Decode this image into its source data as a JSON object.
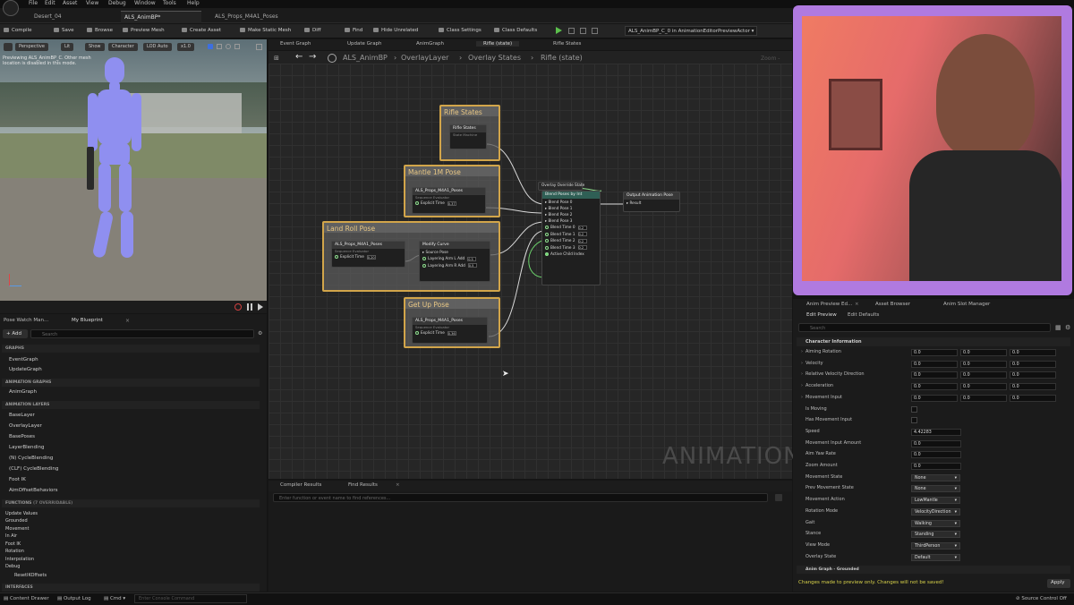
{
  "menu": [
    "File",
    "Edit",
    "Asset",
    "View",
    "Debug",
    "Window",
    "Tools",
    "Help"
  ],
  "doc_tabs": [
    "Desert_04",
    "ALS_AnimBP*",
    "ALS_Props_M4A1_Poses"
  ],
  "compile_label": "Compile",
  "toolbar": [
    "Save",
    "Browse",
    "Preview Mesh",
    "Create Asset",
    "Make Static Mesh",
    "Diff",
    "Find",
    "Hide Unrelated",
    "Class Settings",
    "Class Defaults"
  ],
  "debug_object": "ALS_AnimBP_C_0 in AnimationEditorPreviewActor",
  "viewport": {
    "buttons": [
      "Perspective",
      "Lit",
      "Show",
      "Character",
      "LOD Auto",
      "x1.0"
    ],
    "message": "Previewing ALS_AnimBP_C. Other mesh location is disabled in this mode."
  },
  "graph_tabs": [
    "Event Graph",
    "Update Graph",
    "AnimGraph",
    "Rifle (state)",
    "Rifle States"
  ],
  "breadcrumb": [
    "ALS_AnimBP",
    "OverlayLayer",
    "Overlay States",
    "Rifle (state)"
  ],
  "zoom": "Zoom -",
  "comments": {
    "rifle_states": "Rifle States",
    "mantle": "Mantle 1M Pose",
    "land_roll": "Land Roll Pose",
    "get_up": "Get Up Pose"
  },
  "nodes": {
    "rifle_states": {
      "title": "Rifle States",
      "sub": "State Machine"
    },
    "mantle_seq": {
      "title": "ALS_Props_M4A1_Poses",
      "sub": "Sequence Evaluator",
      "pin": "Explicit Time",
      "val": "0.37"
    },
    "land_seq": {
      "title": "ALS_Props_M4A1_Poses",
      "sub": "Sequence Evaluator",
      "pin": "Explicit Time",
      "val": "0.20"
    },
    "modify": {
      "title": "Modify Curve",
      "pins": [
        "Source Pose",
        "Layering Arm L Add",
        "Layering Arm R Add"
      ],
      "vals": [
        "0.5",
        "0.5"
      ]
    },
    "getup_seq": {
      "title": "ALS_Props_M4A1_Poses",
      "sub": "Sequence Evaluator",
      "pin": "Explicit Time",
      "val": "0.36"
    },
    "blend": {
      "title": "Blend Poses by Int",
      "enum": "Overlay Override State",
      "pins": [
        "Blend Pose 0",
        "Blend Pose 1",
        "Blend Pose 2",
        "Blend Pose 3",
        "Blend Time 0",
        "Blend Time 1",
        "Blend Time 2",
        "Blend Time 3",
        "Active Child Index"
      ],
      "vals": [
        "0.2",
        "0.2",
        "0.2",
        "0.2"
      ]
    },
    "output": {
      "title": "Output Animation Pose",
      "pin": "Result"
    }
  },
  "watermark": "ANIMATION",
  "bottom_tabs": [
    "Compiler Results",
    "Find Results"
  ],
  "bottom_search_placeholder": "Enter function or event name to find references...",
  "mybp": {
    "tabs": [
      "Pose Watch Man...",
      "My Blueprint"
    ],
    "add": "+ Add",
    "search": "Search",
    "graphs_h": "GRAPHS",
    "graphs": [
      "EventGraph",
      "UpdateGraph"
    ],
    "anim_graphs_h": "ANIMATION GRAPHS",
    "anim_graphs": [
      "AnimGraph"
    ],
    "anim_layers_h": "ANIMATION LAYERS",
    "anim_layers": [
      "BaseLayer",
      "OverlayLayer",
      "BasePoses",
      "LayerBlending",
      "(N) CycleBlending",
      "(CLF) CycleBlending",
      "Foot IK",
      "AimOffsetBehaviors"
    ],
    "functions_h": "FUNCTIONS",
    "functions_badge": "(7 OVERRIDABLE)",
    "functions": [
      "Update Values",
      "Grounded",
      "Movement",
      "In Air",
      "Foot IK",
      "Rotation",
      "Interpolation",
      "Debug",
      "ResetIKOffsets"
    ],
    "interfaces_h": "INTERFACES"
  },
  "details": {
    "tabs": [
      "Anim Preview Ed...",
      "Asset Browser",
      "Anim Slot Manager"
    ],
    "subtabs": [
      "Edit Preview",
      "Edit Defaults"
    ],
    "search": "Search",
    "section": "Character Information",
    "vec_rows": [
      {
        "label": "Aiming Rotation",
        "v": [
          "0.0",
          "0.0",
          "0.0"
        ]
      },
      {
        "label": "Velocity",
        "v": [
          "0.0",
          "0.0",
          "0.0"
        ]
      },
      {
        "label": "Relative Velocity Direction",
        "v": [
          "0.0",
          "0.0",
          "0.0"
        ]
      },
      {
        "label": "Acceleration",
        "v": [
          "0.0",
          "0.0",
          "0.0"
        ]
      },
      {
        "label": "Movement Input",
        "v": [
          "0.0",
          "0.0",
          "0.0"
        ]
      }
    ],
    "check_rows": [
      "Is Moving",
      "Has Movement Input"
    ],
    "num_rows": [
      {
        "label": "Speed",
        "v": "4.42283"
      },
      {
        "label": "Movement Input Amount",
        "v": "0.0"
      },
      {
        "label": "Aim Yaw Rate",
        "v": "0.0"
      },
      {
        "label": "Zoom Amount",
        "v": "0.0"
      }
    ],
    "drop_rows": [
      {
        "label": "Movement State",
        "v": "None"
      },
      {
        "label": "Prev Movement State",
        "v": "None"
      },
      {
        "label": "Movement Action",
        "v": "LowMantle"
      },
      {
        "label": "Rotation Mode",
        "v": "VelocityDirection"
      },
      {
        "label": "Gait",
        "v": "Walking"
      },
      {
        "label": "Stance",
        "v": "Standing"
      },
      {
        "label": "View Mode",
        "v": "ThirdPerson"
      },
      {
        "label": "Overlay State",
        "v": "Default"
      }
    ],
    "section2": "Anim Graph - Grounded",
    "warning": "Changes made to preview only. Changes will not be saved!",
    "apply": "Apply"
  },
  "status": {
    "content_drawer": "Content Drawer",
    "output_log": "Output Log",
    "cmd": "Cmd",
    "console": "Enter Console Command",
    "source_control": "Source Control Off"
  }
}
